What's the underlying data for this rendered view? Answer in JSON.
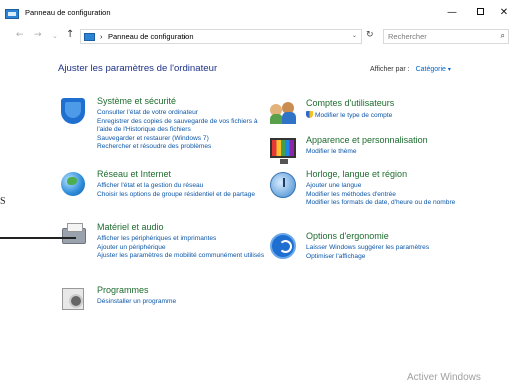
{
  "window": {
    "title": "Panneau de configuration",
    "minimize": "—",
    "close": "✕"
  },
  "nav": {
    "back": "←",
    "forward": "→",
    "history": "⌄",
    "up": "↑",
    "sep": "›",
    "breadcrumb": "Panneau de configuration",
    "address_dropdown": "⌄",
    "refresh": "↻",
    "search_placeholder": "Rechercher",
    "search_icon": "⌕"
  },
  "header": {
    "title": "Ajuster les paramètres de l'ordinateur",
    "view_by_label": "Afficher par :",
    "view_by_value": "Catégorie",
    "view_by_caret": "▾"
  },
  "categories": {
    "system": {
      "icon": "shield-icon",
      "name": "Système et sécurité",
      "links": [
        "Consulter l'état de votre ordinateur",
        "Enregistrer des copies de sauvegarde de vos fichiers à l'aide de l'Historique des fichiers",
        "Sauvegarder et restaurer (Windows 7)",
        "Rechercher et résoudre des problèmes"
      ]
    },
    "network": {
      "icon": "globe-icon",
      "name": "Réseau et Internet",
      "links": [
        "Afficher l'état et la gestion du réseau",
        "Choisir les options de groupe résidentiel et de partage"
      ]
    },
    "hardware": {
      "icon": "printer-icon",
      "name": "Matériel et audio",
      "links": [
        "Afficher les périphériques et imprimantes",
        "Ajouter un périphérique",
        "Ajuster les paramètres de mobilité communément utilisés"
      ]
    },
    "programs": {
      "icon": "programs-icon",
      "name": "Programmes",
      "links": [
        "Désinstaller un programme"
      ]
    },
    "users": {
      "icon": "users-icon",
      "name": "Comptes d'utilisateurs",
      "links": [
        "Modifier le type de compte"
      ]
    },
    "appearance": {
      "icon": "monitor-icon",
      "name": "Apparence et personnalisation",
      "links": [
        "Modifier le thème"
      ]
    },
    "clock": {
      "icon": "clock-icon",
      "name": "Horloge, langue et région",
      "links": [
        "Ajouter une langue",
        "Modifier les méthodes d'entrée",
        "Modifier les formats de date, d'heure ou de nombre"
      ]
    },
    "ease": {
      "icon": "ease-of-access-icon",
      "name": "Options d'ergonomie",
      "links": [
        "Laisser Windows suggérer les paramètres",
        "Optimiser l'affichage"
      ]
    }
  },
  "overlay": {
    "edge_letter": "S",
    "watermark": "Activer Windows"
  },
  "colors": {
    "heading": "#1e3287",
    "category_title": "#1e6c2e",
    "link": "#0b56a8",
    "watermark": "#a0a0a0"
  }
}
